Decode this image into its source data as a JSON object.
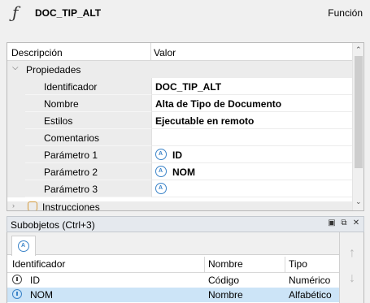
{
  "header": {
    "title": "DOC_TIP_ALT",
    "type_label": "Función",
    "icon": "function-icon"
  },
  "properties": {
    "columns": {
      "description": "Descripción",
      "value": "Valor"
    },
    "group_label": "Propiedades",
    "rows": [
      {
        "name": "Identificador",
        "value": "DOC_TIP_ALT"
      },
      {
        "name": "Nombre",
        "value": "Alta de Tipo de Documento"
      },
      {
        "name": "Estilos",
        "value": "Ejecutable en remoto"
      },
      {
        "name": "Comentarios",
        "value": ""
      },
      {
        "name": "Parámetro 1",
        "value": "ID",
        "icon": "parameter-icon"
      },
      {
        "name": "Parámetro 2",
        "value": "NOM",
        "icon": "parameter-icon"
      },
      {
        "name": "Parámetro 3",
        "value": "",
        "icon": "parameter-icon"
      }
    ],
    "next_group_label": "Instrucciones"
  },
  "subobjects": {
    "title": "Subobjetos (Ctrl+3)",
    "columns": {
      "id": "Identificador",
      "name": "Nombre",
      "type": "Tipo"
    },
    "rows": [
      {
        "id": "ID",
        "name": "Código",
        "type": "Numérico",
        "selected": false
      },
      {
        "id": "NOM",
        "name": "Nombre",
        "type": "Alfabético",
        "selected": true
      }
    ]
  },
  "colors": {
    "accent": "#3a83c8",
    "selection": "#cce4f7",
    "instruction_icon": "#d39b3f"
  }
}
